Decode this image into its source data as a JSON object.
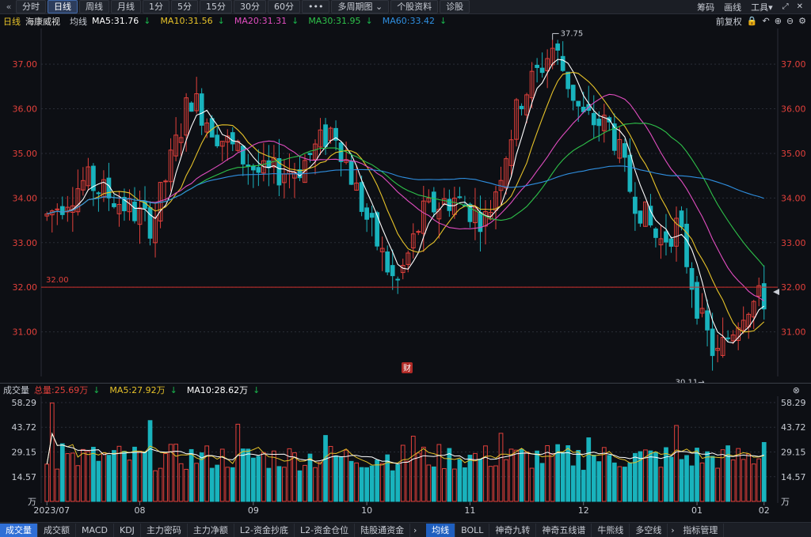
{
  "toolbar": {
    "back_icon": "double-chevron-left-icon",
    "periods": [
      "分时",
      "日线",
      "周线",
      "月线",
      "1分",
      "5分",
      "15分",
      "30分",
      "60分",
      "•••"
    ],
    "active_period": "日线",
    "multi_period": "多周期图",
    "stock_info": "个股资料",
    "diagnose": "诊股",
    "right": [
      "筹码",
      "画线",
      "工具"
    ]
  },
  "ma_bar": {
    "period_label": "日线",
    "stock_name": "海康威视",
    "line_label": "均线",
    "ma5": "MA5:31.76",
    "ma10": "MA10:31.56",
    "ma20": "MA20:31.31",
    "ma30": "MA30:31.95",
    "ma60": "MA60:33.42",
    "adjust": "前复权"
  },
  "vol_bar": {
    "title": "成交量",
    "total": "总量:25.69万",
    "ma5": "MA5:27.92万",
    "ma10": "MA10:28.62万"
  },
  "bottom_tabs": [
    "成交量",
    "成交额",
    "MACD",
    "KDJ",
    "主力密码",
    "主力净额",
    "L2-资金抄底",
    "L2-资金仓位",
    "陆股通资金"
  ],
  "bottom_tabs2": [
    "均线",
    "BOLL",
    "神奇九转",
    "神奇五线谱",
    "牛熊线",
    "多空线",
    "指标管理"
  ],
  "colors": {
    "up": "#e2403b",
    "down": "#19b3bd",
    "ma5": "#ffffff",
    "ma10": "#e6c229",
    "ma20": "#e14dc0",
    "ma30": "#2ec24a",
    "ma60": "#2f8fe0"
  },
  "chart_data": {
    "type": "candlestick",
    "price_axis": [
      "37.00",
      "36.00",
      "35.00",
      "34.00",
      "33.00",
      "32.00",
      "31.00"
    ],
    "price_ylim": [
      30.0,
      37.8
    ],
    "hline_label": "32.00",
    "hline_value": 32.0,
    "high_label": "37.75",
    "low_label": "30.11",
    "finance_marker": "财",
    "x_labels": [
      "2023/07",
      "08",
      "09",
      "10",
      "11",
      "12",
      "01",
      "02"
    ],
    "volume_axis": [
      "58.29",
      "43.72",
      "29.15",
      "14.57",
      "万"
    ],
    "volume_ylim": [
      0,
      58.29
    ]
  }
}
